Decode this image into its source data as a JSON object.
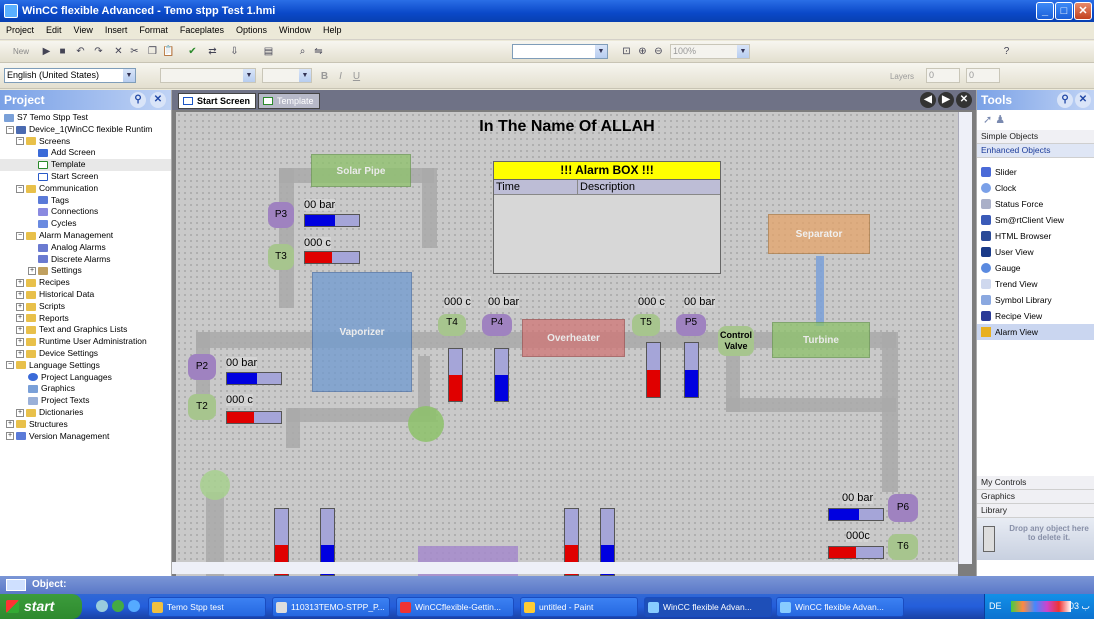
{
  "window": {
    "title": "WinCC flexible Advanced - Temo stpp Test 1.hmi",
    "min": "_",
    "max": "□",
    "close": "✕"
  },
  "menu": [
    "Project",
    "Edit",
    "View",
    "Insert",
    "Format",
    "Faceplates",
    "Options",
    "Window",
    "Help"
  ],
  "toolbar": {
    "new_label": "New",
    "zoom_value": "100%",
    "language": "English (United States)",
    "layers_label": "Layers",
    "layer_from": "0",
    "layer_to": "0"
  },
  "project": {
    "title": "Project",
    "tree": [
      "S7 Temo Stpp Test",
      "Device_1(WinCC flexible Runtim",
      "Screens",
      "Add Screen",
      "Template",
      "Start Screen",
      "Communication",
      "Tags",
      "Connections",
      "Cycles",
      "Alarm Management",
      "Analog Alarms",
      "Discrete Alarms",
      "Settings",
      "Recipes",
      "Historical Data",
      "Scripts",
      "Reports",
      "Text and Graphics Lists",
      "Runtime User Administration",
      "Device Settings",
      "Language Settings",
      "Project Languages",
      "Graphics",
      "Project Texts",
      "Dictionaries",
      "Structures",
      "Version Management"
    ]
  },
  "tabs": [
    "Start Screen",
    "Template"
  ],
  "screen": {
    "heading": "In The Name Of ALLAH",
    "alarm": {
      "title": "!!! Alarm BOX !!!",
      "col_time": "Time",
      "col_desc": "Description"
    },
    "equipment": {
      "solar_pipe": "Solar Pipe",
      "vaporizer": "Vaporizer",
      "overheater": "Overheater",
      "separator": "Separator",
      "turbine": "Turbine",
      "control_valve": "Control Valve"
    },
    "tags": {
      "p3": "P3",
      "t3": "T3",
      "t4": "T4",
      "p4": "P4",
      "t5": "T5",
      "p5": "P5",
      "p2": "P2",
      "t2": "T2",
      "p6": "P6",
      "t6": "T6"
    },
    "values": {
      "p3": "00 bar",
      "t3": "000 c",
      "t4": "000 c",
      "p4": "00 bar",
      "t5": "000 c",
      "p5": "00 bar",
      "p2": "00 bar",
      "t2": "000 c",
      "p6": "00 bar",
      "t6": "000c"
    },
    "levels": {
      "p3_fill": 0.55,
      "t3_fill": 0.5,
      "p2_fill": 0.55,
      "t2_fill": 0.5,
      "p6_fill": 0.55,
      "t6_fill": 0.5
    }
  },
  "tools": {
    "title": "Tools",
    "sections": [
      "Simple Objects",
      "Enhanced Objects"
    ],
    "items": [
      "Slider",
      "Clock",
      "Status Force",
      "Sm@rtClient View",
      "HTML Browser",
      "User View",
      "Gauge",
      "Trend View",
      "Symbol Library",
      "Recipe View",
      "Alarm View"
    ],
    "bottom_sections": [
      "My Controls",
      "Graphics",
      "Library"
    ],
    "trash_text": "Drop any object here to delete it."
  },
  "objectbar": {
    "label": "Object:"
  },
  "taskbar": {
    "start": "start",
    "tasks": [
      "Temo Stpp test",
      "110313TEMO-STPP_P...",
      "WinCCflexible-Gettin...",
      "untitled - Paint",
      "WinCC flexible Advan...",
      "WinCC flexible Advan..."
    ],
    "lang": "DE",
    "clock": "03:03 ب"
  }
}
